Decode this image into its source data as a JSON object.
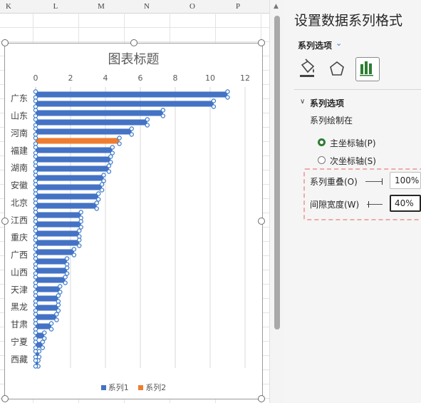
{
  "sheet": {
    "columns": [
      "K",
      "L",
      "M",
      "N",
      "O",
      "P"
    ]
  },
  "chart": {
    "title": "图表标题",
    "legend": [
      {
        "name": "系列1",
        "color": "#4472c4"
      },
      {
        "name": "系列2",
        "color": "#ed7d31"
      }
    ]
  },
  "chart_data": {
    "type": "bar",
    "orientation": "horizontal",
    "title": "图表标题",
    "xlim": [
      0,
      12
    ],
    "xticks": [
      0,
      2,
      4,
      6,
      8,
      10,
      12
    ],
    "grid": true,
    "legend_position": "bottom",
    "categories": [
      "广东",
      "广东",
      "山东",
      "河南",
      "河南",
      "福建",
      "福建",
      "湖南",
      "湖南",
      "安徽",
      "安徽",
      "北京",
      "北京",
      "江西",
      "江西",
      "重庆",
      "重庆",
      "广西",
      "广西",
      "山西",
      "山西",
      "天津",
      "天津",
      "黑龙",
      "黑龙",
      "甘肃",
      "甘肃",
      "宁夏",
      "宁夏",
      "西藏"
    ],
    "category_labels_shown": [
      "广东",
      "山东",
      "河南",
      "福建",
      "湖南",
      "安徽",
      "北京",
      "江西",
      "重庆",
      "广西",
      "山西",
      "天津",
      "黑龙",
      "甘肃",
      "宁夏",
      "西藏"
    ],
    "values": [
      11.0,
      10.2,
      7.3,
      6.4,
      5.5,
      4.8,
      4.4,
      4.3,
      4.2,
      3.9,
      3.8,
      3.6,
      3.5,
      2.6,
      2.6,
      2.5,
      2.5,
      2.2,
      1.8,
      1.8,
      1.7,
      1.4,
      1.3,
      1.3,
      1.2,
      0.9,
      0.5,
      0.4,
      0.2,
      0.15
    ],
    "highlight_index": 5,
    "series": [
      {
        "name": "系列1",
        "color": "#4472c4"
      },
      {
        "name": "系列2",
        "color": "#ed7d31"
      }
    ]
  },
  "pane": {
    "title": "设置数据系列格式",
    "options_dropdown": "系列选项",
    "section_title": "系列选项",
    "plot_on_label": "系列绘制在",
    "primary_axis": "主坐标轴(P)",
    "secondary_axis": "次坐标轴(S)",
    "overlap_label": "系列重叠(O)",
    "overlap_value": "100%",
    "gap_label": "间隙宽度(W)",
    "gap_value": "40%"
  }
}
